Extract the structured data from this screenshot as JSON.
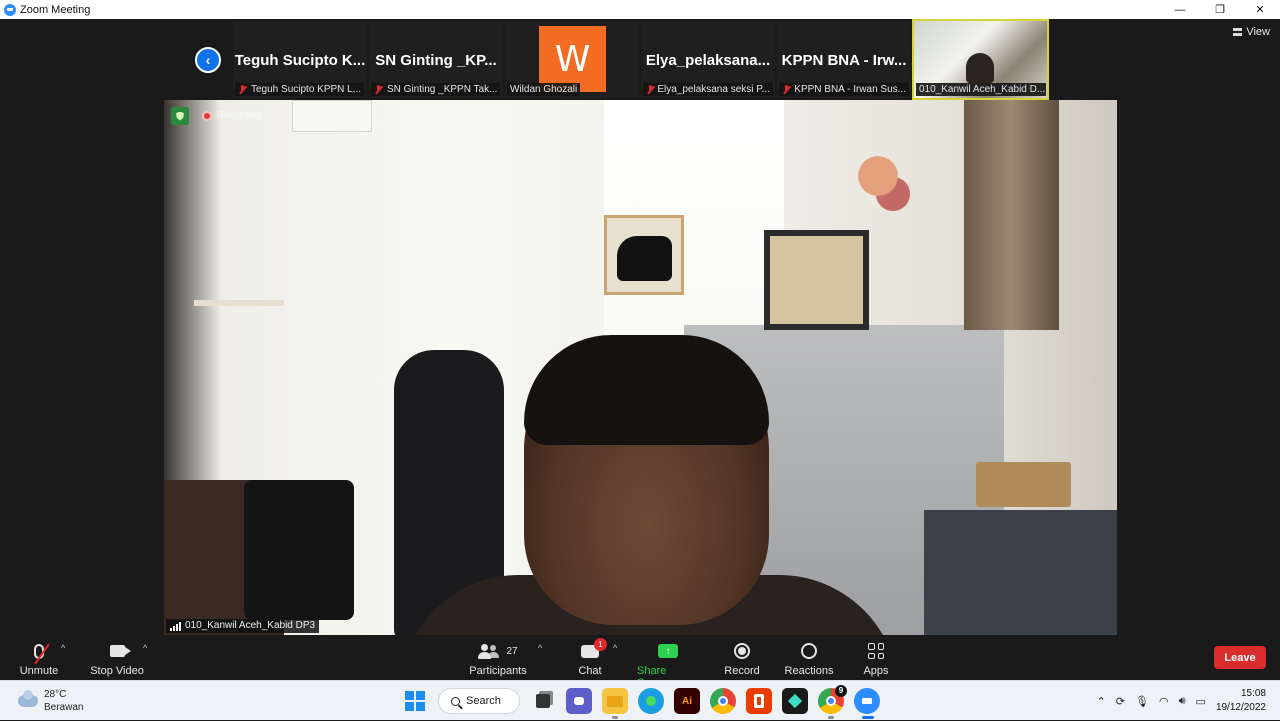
{
  "window": {
    "title": "Zoom Meeting",
    "minimize": "—",
    "restore": "❐",
    "close": "✕"
  },
  "view_button": {
    "label": "View"
  },
  "gallery": [
    {
      "big_name": "Teguh Sucipto K...",
      "small_name": "Teguh Sucipto KPPN L...",
      "muted": true
    },
    {
      "big_name": "SN Ginting _KP...",
      "small_name": "SN Ginting _KPPN Tak...",
      "muted": true
    },
    {
      "avatar_letter": "W",
      "small_name": "Wildan Ghozali",
      "muted": false,
      "avatar_color": "#f26d21"
    },
    {
      "big_name": "Elya_pelaksana...",
      "small_name": "Elya_pelaksana seksi P...",
      "muted": true
    },
    {
      "big_name": "KPPN BNA - Irw...",
      "small_name": "KPPN BNA - Irwan Sus...",
      "muted": true
    },
    {
      "small_name": "010_Kanwil Aceh_Kabid D...",
      "muted": false,
      "video": true
    }
  ],
  "main_video": {
    "name": "010_Kanwil Aceh_Kabid DP3",
    "recording_label": "Recording"
  },
  "toolbar": {
    "unmute": "Unmute",
    "stop_video": "Stop Video",
    "participants": "Participants",
    "participants_count": "27",
    "chat": "Chat",
    "chat_badge": "1",
    "share_screen": "Share Screen",
    "record": "Record",
    "reactions": "Reactions",
    "apps": "Apps",
    "leave": "Leave"
  },
  "taskbar": {
    "weather_temp": "28°C",
    "weather_desc": "Berawan",
    "search_label": "Search",
    "chrome_badge": "9",
    "time": "15:08",
    "date": "19/12/2022"
  },
  "colors": {
    "accent": "#0e72ed",
    "leave": "#d92d2d",
    "share": "#2fd04f",
    "muted": "#e02828"
  }
}
